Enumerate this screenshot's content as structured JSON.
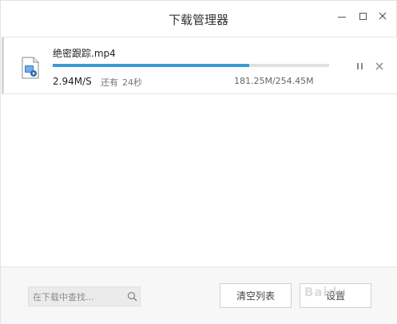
{
  "window": {
    "title": "下载管理器"
  },
  "download": {
    "file_name": "绝密跟踪.mp4",
    "progress": 0.71,
    "speed": "2.94M/S",
    "remaining_label": "还有",
    "remaining_time": "24秒",
    "size": "181.25M/254.45M"
  },
  "footer": {
    "search_placeholder": "在下载中查找...",
    "clear_label": "清空列表",
    "settings_label": "设置"
  },
  "watermark": "Baidu",
  "colors": {
    "progress": "#3b9ad9",
    "track": "#e1e1e1",
    "footer_bg": "#f7f7f7"
  }
}
